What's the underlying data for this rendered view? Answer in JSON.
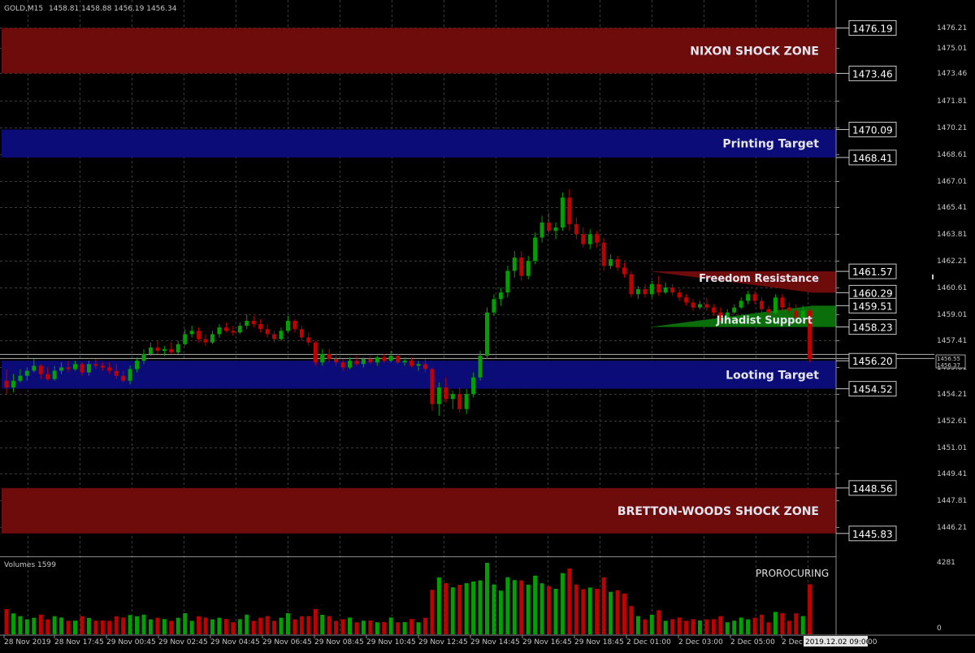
{
  "header": {
    "symbol": "GOLD,M15",
    "ohlc": "1458.81 1458.88 1456.19 1456.34"
  },
  "colors": {
    "background": "#000000",
    "grid": "#3a3a3a",
    "bull": "#00a000",
    "bear": "#c00000",
    "shock_zone": "#6e0b0b",
    "target_zone": "#0c0c78",
    "resistance": "#6e0b0b",
    "support": "#0a6e0a",
    "axis_text": "#c8c8c8"
  },
  "price_axis": {
    "ticks": [
      "1476.21",
      "1475.01",
      "1473.46",
      "1471.81",
      "1470.21",
      "1468.61",
      "1467.01",
      "1465.41",
      "1463.81",
      "1462.21",
      "1460.61",
      "1459.01",
      "1457.41",
      "1455.81",
      "1454.21",
      "1452.61",
      "1451.01",
      "1449.41",
      "1447.81",
      "1446.21"
    ],
    "current_price_box": [
      "1456.55",
      "1456.37"
    ]
  },
  "zones": [
    {
      "label": "NIXON SHOCK ZONE",
      "top": "1476.19",
      "bottom": "1473.46",
      "kind": "shock"
    },
    {
      "label": "Printing Target",
      "top": "1470.09",
      "bottom": "1468.41",
      "kind": "target"
    },
    {
      "label": "Looting Target",
      "top": "1456.20",
      "bottom": "1454.52",
      "kind": "target"
    },
    {
      "label": "BRETTON-WOODS SHOCK ZONE",
      "top": "1448.56",
      "bottom": "1445.83",
      "kind": "shock"
    }
  ],
  "levels": {
    "resistance": {
      "label": "Freedom Resistance",
      "upper": "1461.57",
      "lower": "1460.29"
    },
    "support": {
      "label": "Jihadist Support",
      "upper": "1459.51",
      "lower": "1458.23"
    }
  },
  "time_axis": {
    "labels": [
      "28 Nov 2019",
      "28 Nov 17:45",
      "29 Nov 00:45",
      "29 Nov 02:45",
      "29 Nov 04:45",
      "29 Nov 06:45",
      "29 Nov 08:45",
      "29 Nov 10:45",
      "29 Nov 12:45",
      "29 Nov 14:45",
      "29 Nov 16:45",
      "29 Nov 18:45",
      "2 Dec 01:00",
      "2 Dec 03:00",
      "2 Dec 05:00",
      "2 Dec"
    ],
    "crosshair_time": "2019.12.02 09:06",
    "crosshair_tail": "00"
  },
  "volume_panel": {
    "title": "Volumes 1599",
    "indicator": "PROROCURING",
    "max_label": "4281",
    "min_label": "0"
  },
  "chart_data": {
    "type": "candlestick",
    "symbol": "GOLD",
    "timeframe": "M15",
    "ylim": [
      1445.0,
      1477.5
    ],
    "candles": [
      [
        1455.0,
        1455.7,
        1454.2,
        1454.6
      ],
      [
        1454.6,
        1455.4,
        1454.3,
        1455.0
      ],
      [
        1455.0,
        1455.7,
        1454.9,
        1455.3
      ],
      [
        1455.3,
        1455.8,
        1455.0,
        1455.6
      ],
      [
        1455.6,
        1456.3,
        1455.5,
        1455.9
      ],
      [
        1455.9,
        1456.0,
        1455.1,
        1455.4
      ],
      [
        1455.4,
        1455.8,
        1455.0,
        1455.1
      ],
      [
        1455.1,
        1455.9,
        1455.0,
        1455.6
      ],
      [
        1455.6,
        1456.1,
        1455.4,
        1455.8
      ],
      [
        1455.8,
        1456.2,
        1455.5,
        1455.7
      ],
      [
        1455.7,
        1456.2,
        1455.6,
        1456.0
      ],
      [
        1456.0,
        1456.1,
        1455.3,
        1455.5
      ],
      [
        1455.5,
        1456.2,
        1455.3,
        1456.0
      ],
      [
        1456.0,
        1456.3,
        1455.7,
        1455.9
      ],
      [
        1455.9,
        1456.1,
        1455.6,
        1455.8
      ],
      [
        1455.8,
        1456.1,
        1455.4,
        1455.6
      ],
      [
        1455.6,
        1456.0,
        1455.1,
        1455.3
      ],
      [
        1455.3,
        1455.6,
        1454.9,
        1455.0
      ],
      [
        1455.0,
        1455.9,
        1454.8,
        1455.7
      ],
      [
        1455.7,
        1456.4,
        1455.5,
        1456.2
      ],
      [
        1456.2,
        1456.9,
        1456.0,
        1456.6
      ],
      [
        1456.6,
        1457.3,
        1456.5,
        1457.0
      ],
      [
        1457.0,
        1457.4,
        1456.6,
        1456.8
      ],
      [
        1456.8,
        1457.1,
        1456.5,
        1456.9
      ],
      [
        1456.9,
        1457.3,
        1456.6,
        1456.7
      ],
      [
        1456.7,
        1457.4,
        1456.6,
        1457.2
      ],
      [
        1457.2,
        1458.1,
        1457.1,
        1457.8
      ],
      [
        1457.8,
        1458.3,
        1457.6,
        1458.0
      ],
      [
        1458.0,
        1458.2,
        1457.3,
        1457.5
      ],
      [
        1457.5,
        1457.8,
        1457.1,
        1457.3
      ],
      [
        1457.3,
        1458.0,
        1457.2,
        1457.8
      ],
      [
        1457.8,
        1458.4,
        1457.6,
        1458.2
      ],
      [
        1458.2,
        1458.5,
        1457.9,
        1458.0
      ],
      [
        1458.0,
        1458.3,
        1457.7,
        1457.9
      ],
      [
        1457.9,
        1458.5,
        1457.8,
        1458.3
      ],
      [
        1458.3,
        1459.0,
        1458.1,
        1458.6
      ],
      [
        1458.6,
        1458.9,
        1458.2,
        1458.4
      ],
      [
        1458.4,
        1458.7,
        1457.9,
        1458.1
      ],
      [
        1458.1,
        1458.4,
        1457.6,
        1457.8
      ],
      [
        1457.8,
        1458.0,
        1457.3,
        1457.5
      ],
      [
        1457.5,
        1458.2,
        1457.4,
        1458.0
      ],
      [
        1458.0,
        1458.9,
        1457.9,
        1458.6
      ],
      [
        1458.6,
        1458.7,
        1457.9,
        1458.1
      ],
      [
        1458.1,
        1458.3,
        1457.4,
        1457.6
      ],
      [
        1457.6,
        1457.9,
        1457.1,
        1457.3
      ],
      [
        1457.3,
        1457.4,
        1455.9,
        1456.1
      ],
      [
        1456.1,
        1456.9,
        1455.9,
        1456.6
      ],
      [
        1456.6,
        1456.9,
        1456.1,
        1456.3
      ],
      [
        1456.3,
        1456.6,
        1455.9,
        1456.1
      ],
      [
        1456.1,
        1456.3,
        1455.6,
        1455.8
      ],
      [
        1455.8,
        1456.4,
        1455.7,
        1456.2
      ],
      [
        1456.2,
        1456.5,
        1455.9,
        1456.0
      ],
      [
        1456.0,
        1456.4,
        1455.8,
        1456.3
      ],
      [
        1456.3,
        1456.5,
        1456.0,
        1456.1
      ],
      [
        1456.1,
        1456.5,
        1455.9,
        1456.4
      ],
      [
        1456.4,
        1456.6,
        1456.1,
        1456.2
      ],
      [
        1456.2,
        1456.8,
        1456.1,
        1456.5
      ],
      [
        1456.5,
        1456.6,
        1456.0,
        1456.1
      ],
      [
        1456.1,
        1456.4,
        1455.9,
        1456.2
      ],
      [
        1456.2,
        1456.4,
        1455.8,
        1455.9
      ],
      [
        1455.9,
        1456.2,
        1455.6,
        1456.0
      ],
      [
        1456.0,
        1456.3,
        1455.5,
        1455.7
      ],
      [
        1455.7,
        1455.8,
        1453.2,
        1453.6
      ],
      [
        1453.6,
        1454.9,
        1452.9,
        1454.6
      ],
      [
        1454.6,
        1455.2,
        1453.7,
        1453.9
      ],
      [
        1453.9,
        1454.4,
        1453.3,
        1454.2
      ],
      [
        1454.2,
        1454.6,
        1453.1,
        1453.3
      ],
      [
        1453.3,
        1454.5,
        1453.0,
        1454.2
      ],
      [
        1454.2,
        1455.5,
        1454.0,
        1455.2
      ],
      [
        1455.2,
        1456.8,
        1455.0,
        1456.5
      ],
      [
        1456.5,
        1459.4,
        1456.3,
        1459.1
      ],
      [
        1459.1,
        1460.2,
        1458.9,
        1459.9
      ],
      [
        1459.9,
        1460.6,
        1459.5,
        1460.3
      ],
      [
        1460.3,
        1461.9,
        1460.0,
        1461.6
      ],
      [
        1461.6,
        1462.8,
        1461.2,
        1462.4
      ],
      [
        1462.4,
        1462.8,
        1461.0,
        1461.3
      ],
      [
        1461.3,
        1462.5,
        1461.1,
        1462.2
      ],
      [
        1462.2,
        1463.9,
        1462.0,
        1463.6
      ],
      [
        1463.6,
        1464.9,
        1463.3,
        1464.5
      ],
      [
        1464.5,
        1465.1,
        1463.8,
        1464.0
      ],
      [
        1464.0,
        1464.5,
        1463.5,
        1464.2
      ],
      [
        1464.2,
        1466.3,
        1464.0,
        1466.0
      ],
      [
        1466.0,
        1466.5,
        1464.0,
        1464.4
      ],
      [
        1464.4,
        1464.8,
        1463.5,
        1463.8
      ],
      [
        1463.8,
        1464.2,
        1463.0,
        1463.2
      ],
      [
        1463.2,
        1464.1,
        1462.9,
        1463.8
      ],
      [
        1463.8,
        1464.0,
        1463.0,
        1463.3
      ],
      [
        1463.3,
        1463.6,
        1461.6,
        1461.9
      ],
      [
        1461.9,
        1462.6,
        1461.7,
        1462.3
      ],
      [
        1462.3,
        1462.5,
        1461.6,
        1461.8
      ],
      [
        1461.8,
        1462.1,
        1461.2,
        1461.4
      ],
      [
        1461.4,
        1461.6,
        1460.0,
        1460.2
      ],
      [
        1460.2,
        1460.7,
        1459.9,
        1460.5
      ],
      [
        1460.5,
        1460.8,
        1460.0,
        1460.2
      ],
      [
        1460.2,
        1461.0,
        1460.0,
        1460.8
      ],
      [
        1460.8,
        1461.3,
        1460.1,
        1460.3
      ],
      [
        1460.3,
        1460.9,
        1460.2,
        1460.6
      ],
      [
        1460.6,
        1460.8,
        1460.1,
        1460.3
      ],
      [
        1460.3,
        1460.5,
        1459.8,
        1460.0
      ],
      [
        1460.0,
        1460.2,
        1459.5,
        1459.7
      ],
      [
        1459.7,
        1459.9,
        1459.2,
        1459.4
      ],
      [
        1459.4,
        1459.8,
        1459.3,
        1459.6
      ],
      [
        1459.6,
        1460.0,
        1459.2,
        1459.4
      ],
      [
        1459.4,
        1459.6,
        1458.9,
        1459.1
      ],
      [
        1459.1,
        1459.4,
        1458.6,
        1458.8
      ],
      [
        1458.8,
        1459.3,
        1458.7,
        1459.1
      ],
      [
        1459.1,
        1459.6,
        1459.0,
        1459.4
      ],
      [
        1459.4,
        1460.0,
        1459.3,
        1459.8
      ],
      [
        1459.8,
        1460.4,
        1459.6,
        1460.2
      ],
      [
        1460.2,
        1460.4,
        1459.6,
        1459.8
      ],
      [
        1459.8,
        1460.0,
        1459.1,
        1459.3
      ],
      [
        1459.3,
        1459.5,
        1458.9,
        1459.1
      ],
      [
        1459.1,
        1460.2,
        1459.0,
        1460.0
      ],
      [
        1460.0,
        1460.2,
        1459.2,
        1459.4
      ],
      [
        1459.4,
        1459.7,
        1459.0,
        1459.2
      ],
      [
        1459.2,
        1459.6,
        1458.5,
        1458.8
      ],
      [
        1458.8,
        1459.5,
        1458.7,
        1459.2
      ],
      [
        1459.2,
        1459.3,
        1456.1,
        1456.3
      ]
    ],
    "volumes": [
      1,
      1,
      1,
      1,
      1,
      1,
      1,
      1,
      1,
      1,
      1,
      1,
      1,
      1,
      1,
      1,
      1,
      1,
      1,
      1,
      1,
      1,
      1,
      1,
      1,
      1,
      1,
      1,
      1,
      1,
      1,
      1,
      1,
      1,
      1,
      1,
      1,
      1,
      1,
      1,
      1,
      1,
      1,
      1,
      1,
      1,
      1,
      1,
      1,
      1,
      1,
      1,
      1,
      1,
      1,
      1,
      1,
      1,
      1,
      1,
      1,
      1,
      1,
      1,
      1,
      1,
      1,
      1,
      1,
      1,
      1,
      1,
      1,
      1,
      1,
      1,
      1,
      1,
      1,
      1,
      1,
      1,
      1,
      1,
      1,
      1,
      1,
      1,
      1,
      1,
      1,
      1,
      1,
      1,
      1,
      1,
      1,
      1,
      1,
      1,
      1,
      1,
      1,
      1,
      1,
      1,
      1,
      1,
      1,
      1,
      1,
      1,
      1,
      1,
      1,
      1,
      1,
      1,
      1,
      1,
      1
    ]
  }
}
